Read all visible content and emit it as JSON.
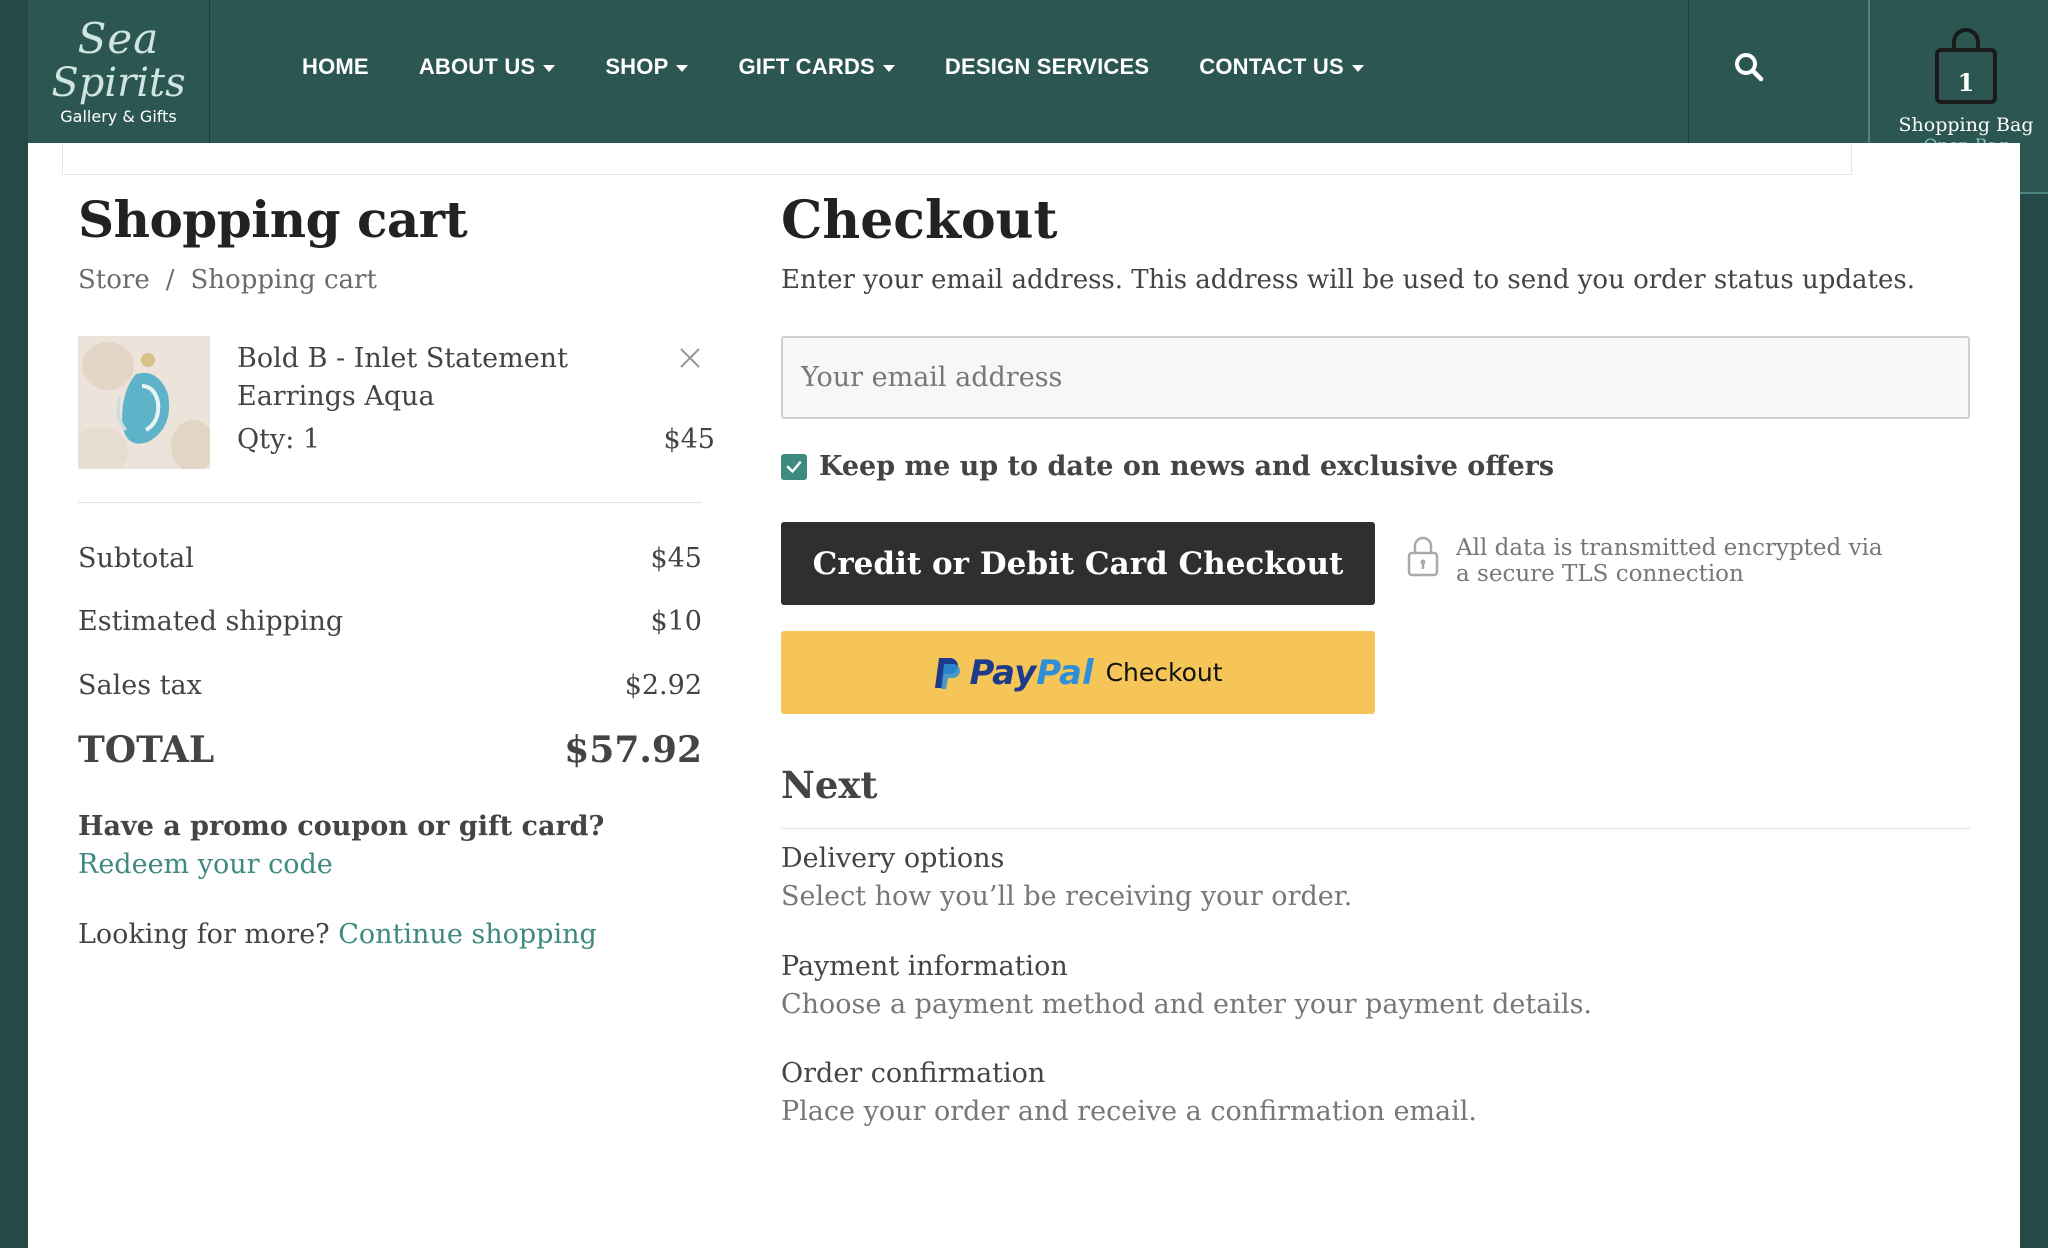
{
  "header": {
    "logo": {
      "line1": "Sea",
      "line2": "Spirits",
      "tagline": "Gallery & Gifts"
    },
    "nav": [
      {
        "label": "HOME",
        "dropdown": false
      },
      {
        "label": "ABOUT US",
        "dropdown": true
      },
      {
        "label": "SHOP",
        "dropdown": true
      },
      {
        "label": "GIFT CARDS",
        "dropdown": true
      },
      {
        "label": "DESIGN SERVICES",
        "dropdown": false
      },
      {
        "label": "CONTACT US",
        "dropdown": true
      }
    ],
    "search_icon": "search-icon",
    "bag": {
      "count": "1",
      "label": "Shopping Bag",
      "open_label": "Open Bag"
    }
  },
  "cart": {
    "title": "Shopping cart",
    "breadcrumb": [
      "Store",
      "/",
      "Shopping cart"
    ],
    "item": {
      "name": "Bold B - Inlet Statement Earrings Aqua",
      "qty": "Qty: 1",
      "price": "$45"
    },
    "summary": [
      {
        "label": "Subtotal",
        "value": "$45"
      },
      {
        "label": "Estimated shipping",
        "value": "$10"
      },
      {
        "label": "Sales tax",
        "value": "$2.92"
      }
    ],
    "total": {
      "label": "TOTAL",
      "value": "$57.92"
    },
    "promo_question": "Have a promo coupon or gift card?",
    "promo_link": "Redeem your code",
    "more_text": "Looking for more?",
    "more_link": "Continue shopping"
  },
  "checkout": {
    "title": "Checkout",
    "subtitle": "Enter your email address. This address will be used to send you order status updates.",
    "email_placeholder": "Your email address",
    "newsletter_label": "Keep me up to date on news and exclusive offers",
    "newsletter_checked": true,
    "card_button": "Credit or Debit Card Checkout",
    "secure_text": "All data is transmitted encrypted via a secure TLS connection",
    "paypal": {
      "pay": "Pay",
      "pal": "Pal",
      "checkout": "Checkout"
    },
    "next_title": "Next",
    "steps": [
      {
        "title": "Delivery options",
        "desc": "Select how you’ll be receiving your order."
      },
      {
        "title": "Payment information",
        "desc": "Choose a payment method and enter your payment details."
      },
      {
        "title": "Order confirmation",
        "desc": "Place your order and receive a confirmation email."
      }
    ]
  },
  "colors": {
    "header_bg": "#2c5652",
    "accent": "#3f8a7f",
    "paypal_bg": "#f5c557",
    "card_button_bg": "#2f2f2f"
  }
}
